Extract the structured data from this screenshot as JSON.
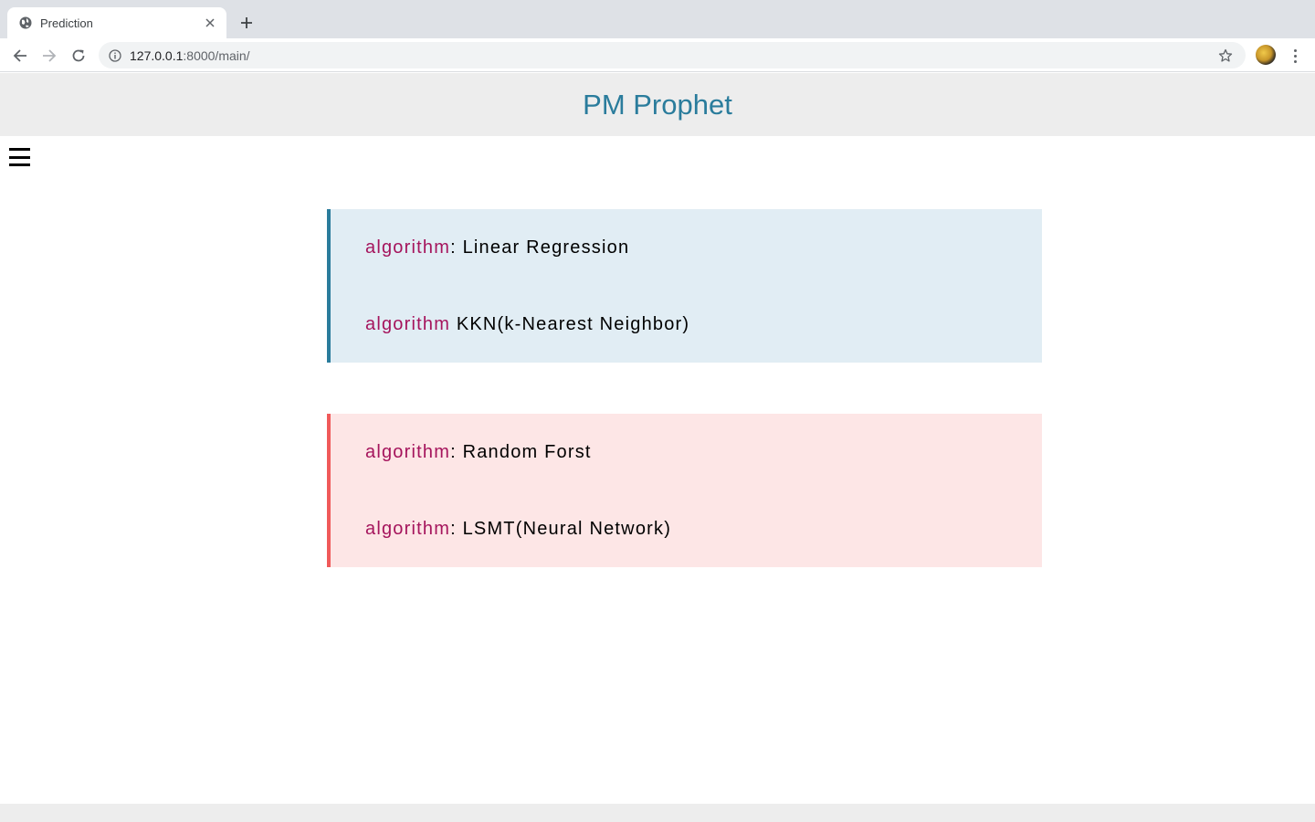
{
  "browser": {
    "tab_title": "Prediction",
    "url_host": "127.0.0.1",
    "url_rest": ":8000/main/"
  },
  "icons": {
    "favicon": "globe-icon",
    "close": "close-icon",
    "new_tab": "plus-icon",
    "back": "back-arrow-icon",
    "forward": "forward-arrow-icon",
    "reload": "reload-icon",
    "info": "info-icon",
    "bookmark": "star-icon",
    "menu": "hamburger-menu-icon",
    "more": "more-vertical-icon"
  },
  "site": {
    "title": "PM Prophet"
  },
  "panels": [
    {
      "theme": "blue",
      "items": [
        {
          "key": "algorithm",
          "sep": ": ",
          "value": "Linear Regression"
        },
        {
          "key": "algorithm",
          "sep": " ",
          "value": "KKN(k-Nearest Neighbor)"
        }
      ]
    },
    {
      "theme": "red",
      "items": [
        {
          "key": "algorithm",
          "sep": ": ",
          "value": "Random Forst"
        },
        {
          "key": "algorithm",
          "sep": ": ",
          "value": "LSMT(Neural Network)"
        }
      ]
    }
  ],
  "colors": {
    "title": "#2a7c9c",
    "keyword": "#a5145c",
    "blue_panel_bg": "#e1edf4",
    "blue_panel_border": "#2a7c9c",
    "red_panel_bg": "#fde6e6",
    "red_panel_border": "#f05a5a",
    "header_bg": "#ededed"
  }
}
